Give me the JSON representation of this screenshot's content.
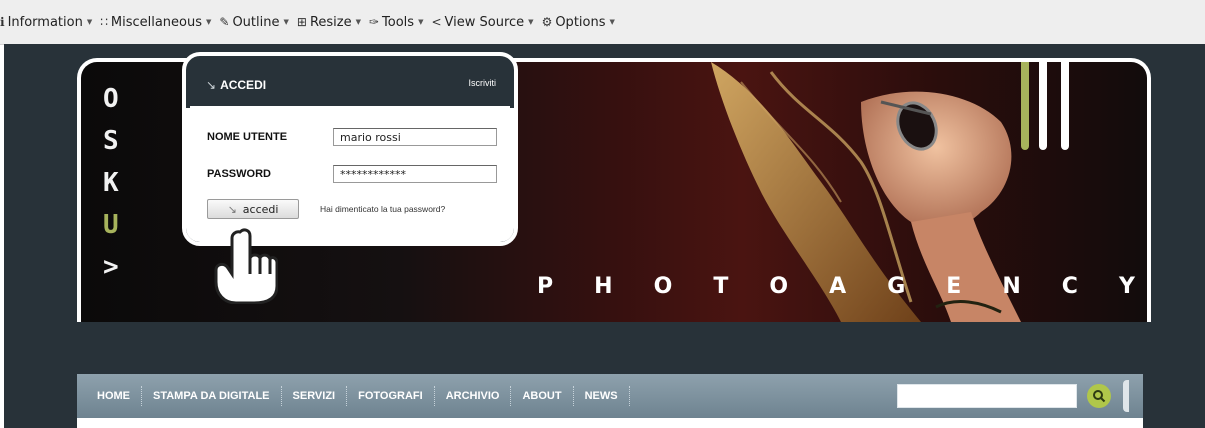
{
  "toolbar": {
    "items": [
      {
        "icon": "info-icon",
        "label": "Information"
      },
      {
        "icon": "grid-icon",
        "label": "Miscellaneous"
      },
      {
        "icon": "pencil-icon",
        "label": "Outline"
      },
      {
        "icon": "resize-icon",
        "label": "Resize"
      },
      {
        "icon": "wrench-icon",
        "label": "Tools"
      },
      {
        "icon": "code-icon",
        "label": "View Source"
      },
      {
        "icon": "gear-icon",
        "label": "Options"
      }
    ]
  },
  "side_glyphs": [
    "O",
    "S",
    "K",
    "U",
    ">"
  ],
  "brand": {
    "wordmark": [
      "P",
      "H",
      "O",
      "T",
      "O",
      "A",
      "G",
      "E",
      "N",
      "C",
      "Y"
    ]
  },
  "header_icons": [
    "sitemap-icon",
    "envelope-icon"
  ],
  "login": {
    "title": "ACCEDI",
    "register_link": "Iscriviti",
    "username_label": "NOME UTENTE",
    "username_value": "mario rossi",
    "password_label": "PASSWORD",
    "password_value": "************",
    "submit_label": "accedi",
    "forgot_link": "Hai dimenticato la tua password?"
  },
  "nav": {
    "items": [
      "HOME",
      "STAMPA DA DIGITALE",
      "SERVIZI",
      "FOTOGRAFI",
      "ARCHIVIO",
      "ABOUT",
      "NEWS"
    ]
  },
  "colors": {
    "background": "#283239",
    "accent": "#a7b35c",
    "nav": "#7b8f9c",
    "search_button": "#b0c74a"
  }
}
